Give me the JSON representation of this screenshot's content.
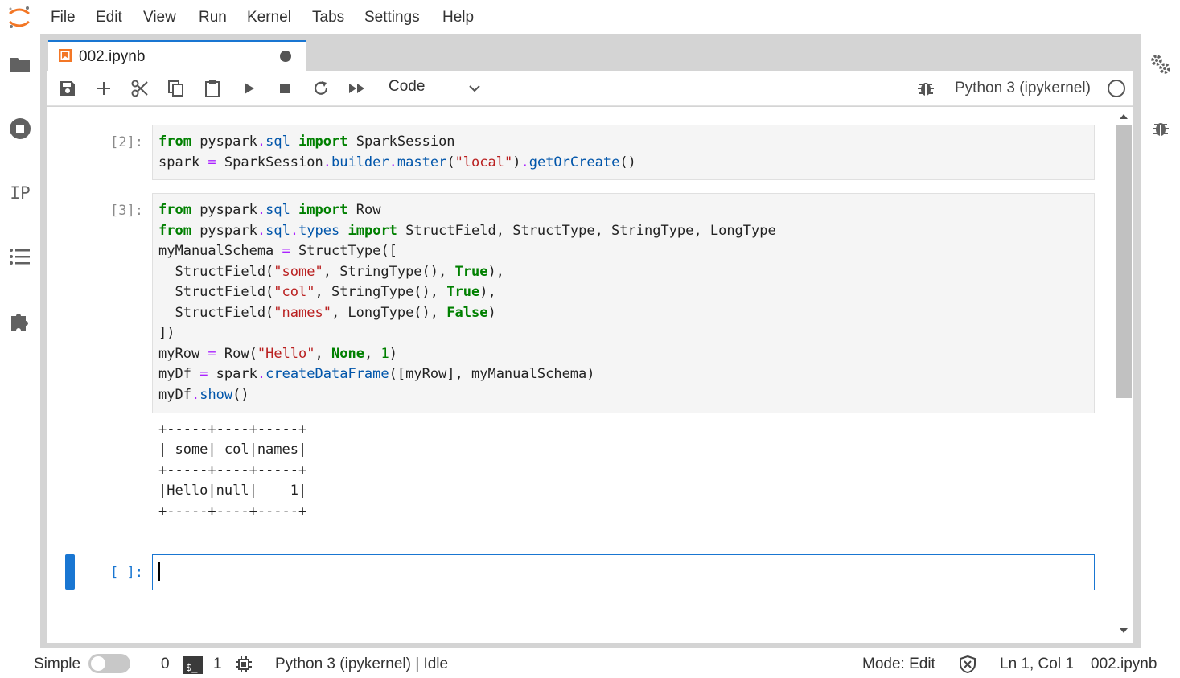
{
  "menu": [
    "File",
    "Edit",
    "View",
    "Run",
    "Kernel",
    "Tabs",
    "Settings",
    "Help"
  ],
  "tab": {
    "label": "002.ipynb"
  },
  "toolbar": {
    "cell_type": "Code",
    "kernel_name": "Python 3 (ipykernel)"
  },
  "cells": [
    {
      "prompt": "[2]:"
    },
    {
      "prompt": "[3]:",
      "output": "+-----+----+-----+\n| some| col|names|\n+-----+----+-----+\n|Hello|null|    1|\n+-----+----+-----+"
    },
    {
      "prompt": "[ ]:"
    }
  ],
  "sidebar_left": {
    "ip_label": "IP"
  },
  "status": {
    "mode_label": "Simple",
    "count_a": "0",
    "count_b": "1",
    "kernel": "Python 3 (ipykernel) | Idle",
    "mode": "Mode: Edit",
    "position": "Ln 1, Col 1",
    "file": "002.ipynb",
    "terminal_glyph": "$_"
  },
  "colors": {
    "accent": "#1976d2",
    "keyword": "#008000",
    "string": "#ba2121",
    "attribute": "#0055aa",
    "operator": "#aa22ff"
  },
  "icons": [
    "jupyter-logo-icon",
    "folder-icon",
    "running-icon",
    "list-icon",
    "puzzle-icon",
    "save-icon",
    "add-icon",
    "cut-icon",
    "copy-icon",
    "paste-icon",
    "run-icon",
    "stop-icon",
    "restart-icon",
    "fast-forward-icon",
    "bug-icon",
    "gears-icon"
  ]
}
